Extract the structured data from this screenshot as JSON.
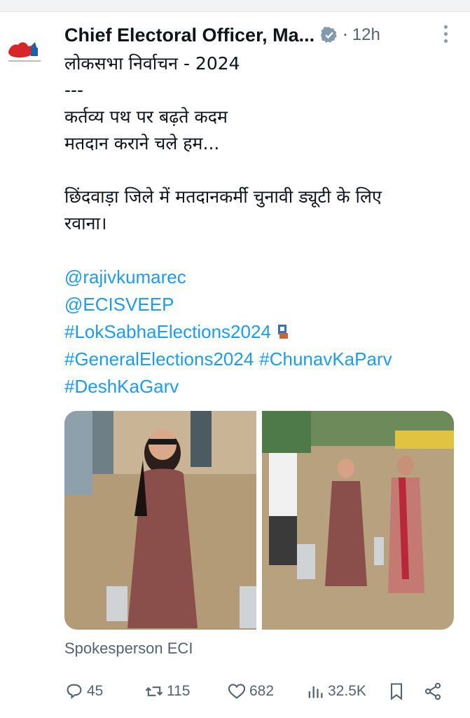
{
  "tweet": {
    "author_name": "Chief Electoral Officer, Ma...",
    "time": "12h",
    "lines": [
      "लोकसभा निर्वाचन - 2024",
      "---",
      "कर्तव्य पथ पर बढ़ते कदम",
      "मतदान कराने चले हम...",
      "",
      "छिंदवाड़ा जिले में मतदानकर्मी चुनावी ड्यूटी के लिए",
      "रवाना।",
      ""
    ],
    "mentions": [
      "@rajivkumarec",
      "@ECISVEEP"
    ],
    "hashtags": [
      "#LokSabhaElections2024",
      "#GeneralElections2024",
      "#ChunavKaParv",
      "#DeshKaGarv"
    ],
    "source": "Spokesperson ECI"
  },
  "actions": {
    "replies": "45",
    "reposts": "115",
    "likes": "682",
    "views": "32.5K"
  },
  "colors": {
    "link": "#1d9bf0",
    "muted": "#536471",
    "text": "#0f1419"
  },
  "icons": [
    "verified-badge-icon",
    "more-icon",
    "reply-icon",
    "repost-icon",
    "like-icon",
    "views-icon",
    "bookmark-icon",
    "share-icon",
    "ballot-box-emoji"
  ]
}
